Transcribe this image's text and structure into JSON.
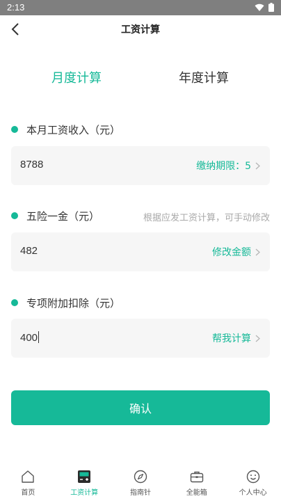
{
  "status_bar": {
    "time": "2:13"
  },
  "nav": {
    "title": "工资计算"
  },
  "tabs": {
    "monthly": "月度计算",
    "yearly": "年度计算"
  },
  "income": {
    "label": "本月工资收入（元）",
    "value": "8788",
    "action": "缴纳期限：5"
  },
  "insurance": {
    "label": "五险一金（元）",
    "hint": "根据应发工资计算，可手动修改",
    "value": "482",
    "action": "修改金额"
  },
  "deduction": {
    "label": "专项附加扣除（元）",
    "value": "400",
    "action": "帮我计算"
  },
  "confirm": {
    "label": "确认"
  },
  "bottom_tabs": [
    {
      "label": "首页",
      "icon": "home-icon"
    },
    {
      "label": "工资计算",
      "icon": "calculator-icon"
    },
    {
      "label": "指南针",
      "icon": "compass-icon"
    },
    {
      "label": "全能箱",
      "icon": "toolbox-icon"
    },
    {
      "label": "个人中心",
      "icon": "smiley-icon"
    }
  ],
  "colors": {
    "accent": "#16b998",
    "status_bar": "#7f7f7f",
    "input_bg": "#f6f6f6"
  }
}
